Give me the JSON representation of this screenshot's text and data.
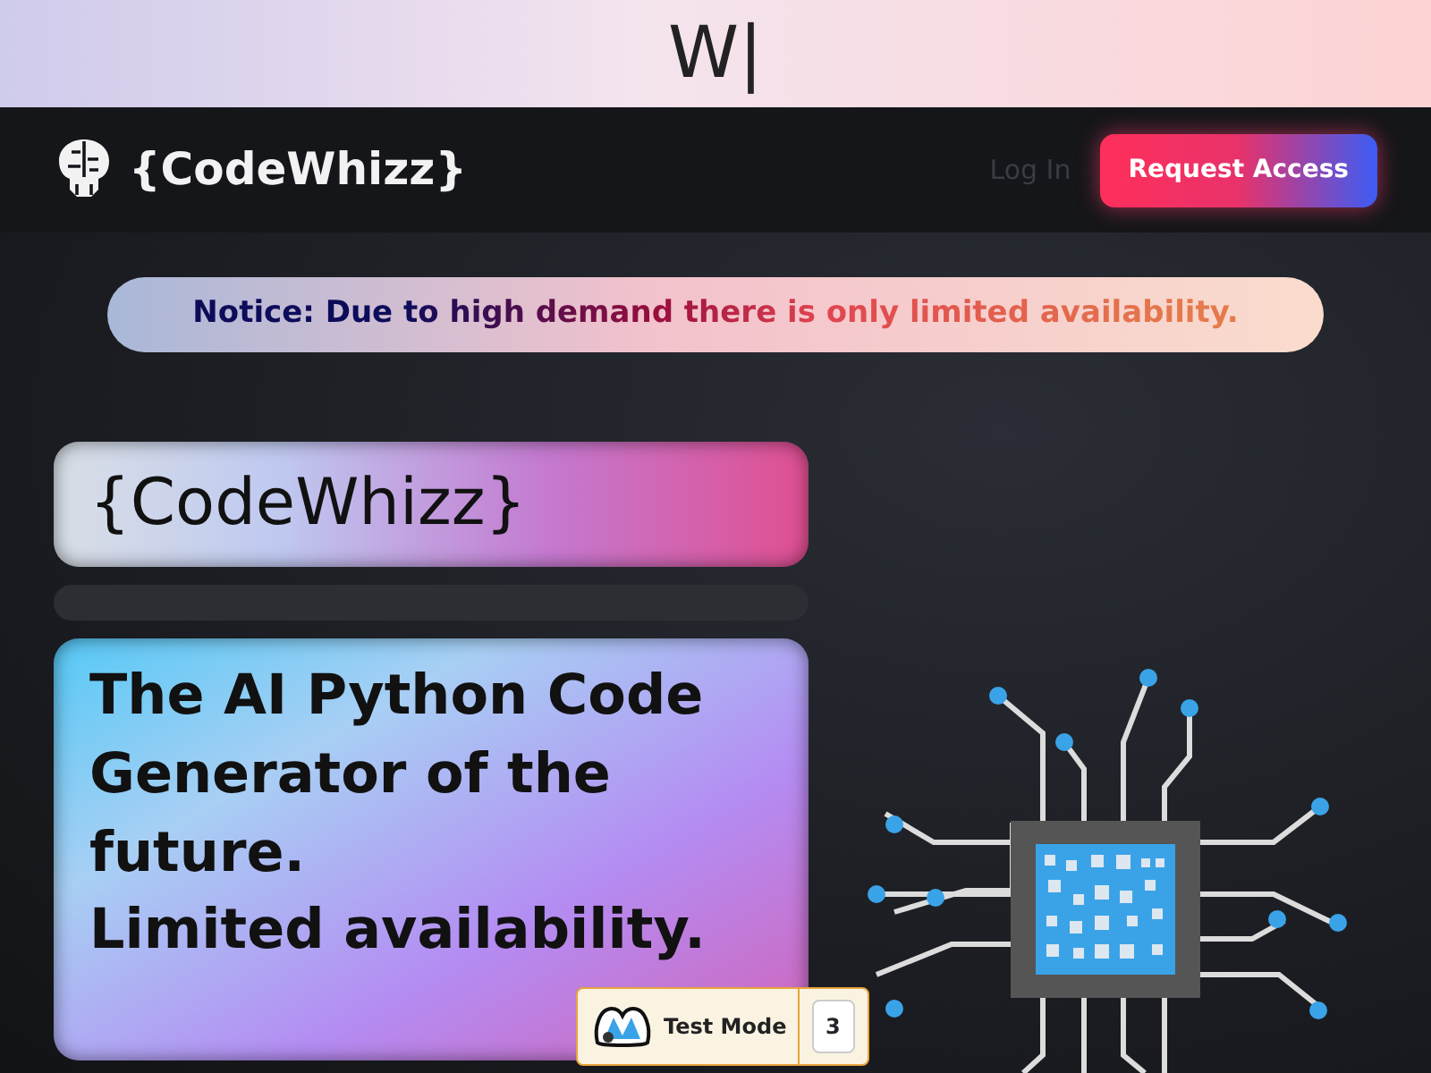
{
  "top_banner": {
    "typed_text": "W|"
  },
  "navbar": {
    "brand": "{CodeWhizz}",
    "links": [
      {
        "label": "Log In",
        "kind": "link"
      },
      {
        "label": "Request Access",
        "kind": "button"
      }
    ]
  },
  "notice": "Notice: Due to high demand there is only limited availability.",
  "hero": {
    "title": "{CodeWhizz}",
    "headline": "The AI Python Code Generator of the future.",
    "subline": "Limited availability."
  },
  "test_mode_badge": {
    "label": "Test Mode",
    "count": "3"
  }
}
